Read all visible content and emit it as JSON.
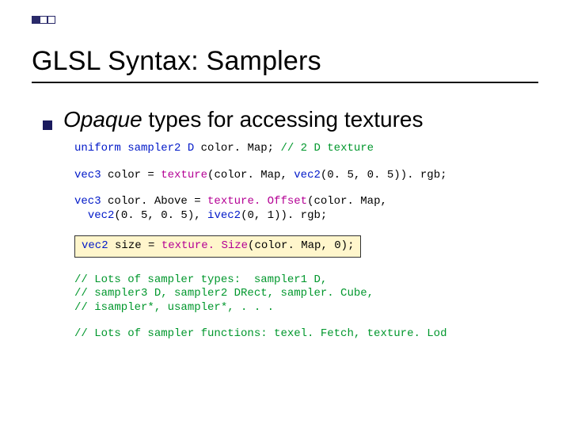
{
  "title": "GLSL Syntax:  Samplers",
  "bullet": {
    "em": "Opaque",
    "rest": " types for accessing textures"
  },
  "code": {
    "line1": {
      "kw1": "uniform",
      "kw2": "sampler2 D",
      "ident": " color. Map; ",
      "cmt": "// 2 D texture"
    },
    "line2": {
      "kw1": "vec3",
      "mid1": " color = ",
      "fn": "texture",
      "mid2": "(color. Map, ",
      "kw2": "vec2",
      "tail": "(0. 5, 0. 5)). rgb;"
    },
    "line3a": {
      "kw1": "vec3",
      "mid1": " color. Above = ",
      "fn": "texture. Offset",
      "tail": "(color. Map,"
    },
    "line3b": {
      "pad": "  ",
      "kw1": "vec2",
      "mid1": "(0. 5, 0. 5), ",
      "kw2": "ivec2",
      "tail": "(0, 1)). rgb;"
    },
    "hl": {
      "kw1": "vec2",
      "mid1": " size = ",
      "fn": "texture. Size",
      "tail": "(color. Map, 0);"
    },
    "cmt1a": "// Lots of sampler types:  sampler1 D,",
    "cmt1b": "// sampler3 D, sampler2 DRect, sampler. Cube,",
    "cmt1c": "// isampler*, usampler*, . . .",
    "cmt2": "// Lots of sampler functions: texel. Fetch, texture. Lod"
  }
}
